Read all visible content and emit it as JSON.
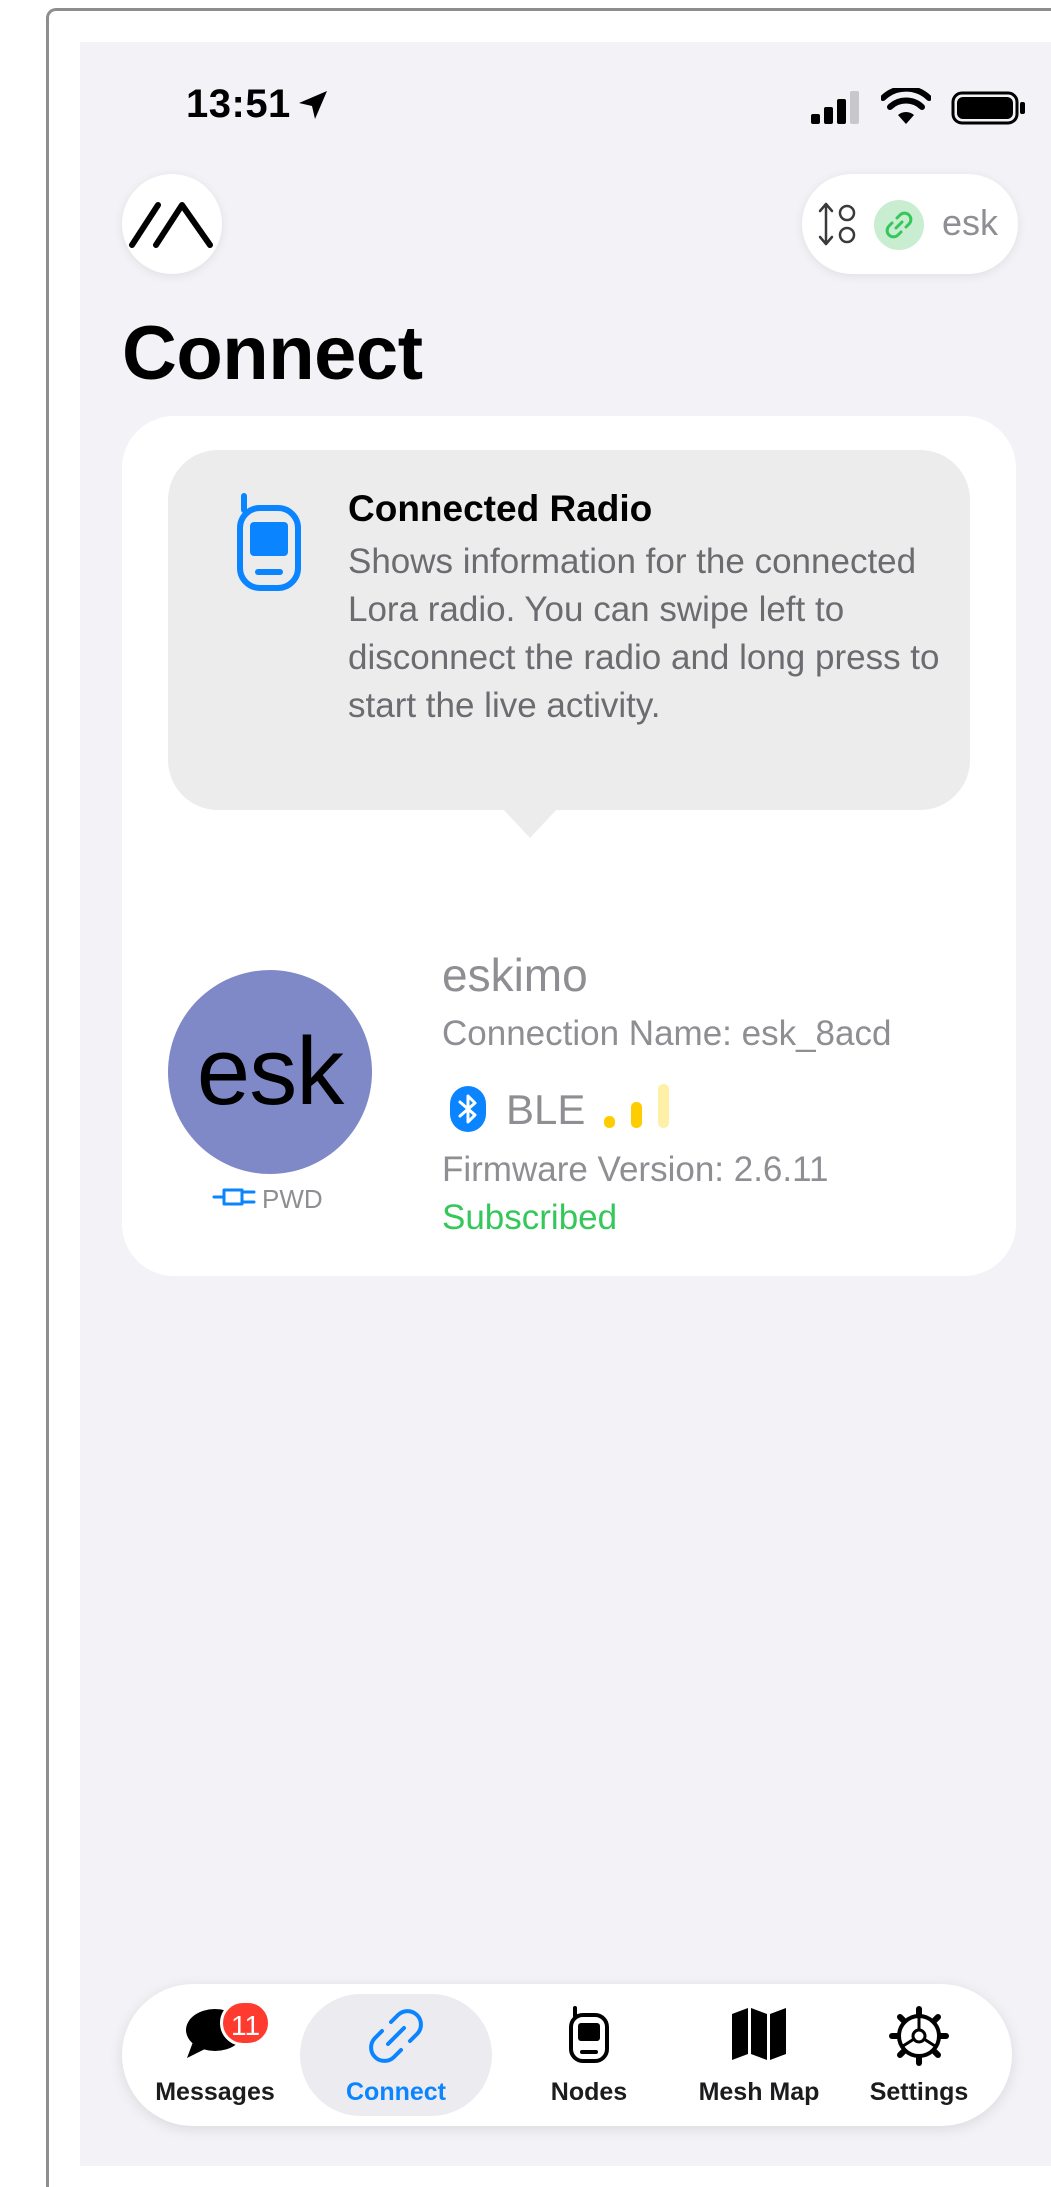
{
  "status_bar": {
    "time": "13:51",
    "icons": [
      "location-arrow-icon",
      "cellular-signal-icon",
      "wifi-icon",
      "battery-icon"
    ]
  },
  "header": {
    "connection_pill": {
      "name": "esk",
      "icons": [
        "sort-arrows-icon",
        "link-icon"
      ]
    }
  },
  "page": {
    "title": "Connect"
  },
  "tip": {
    "title": "Connected Radio",
    "body": "Shows information for the connected Lora radio. You can swipe left to disconnect the radio and long press to start the live activity."
  },
  "radio": {
    "avatar_text": "esk",
    "avatar_color": "#7f89c8",
    "power_label": "PWD",
    "name": "eskimo",
    "connection_name": "Connection Name: esk_8acd",
    "transport": "BLE",
    "signal_strength": "2 of 3",
    "firmware": "Firmware Version: 2.6.11",
    "status": "Subscribed",
    "status_color": "#34c759"
  },
  "tabbar": {
    "tabs": [
      {
        "label": "Messages",
        "icon": "chat-bubble-icon",
        "badge": "11"
      },
      {
        "label": "Connect",
        "icon": "link-icon",
        "active": true
      },
      {
        "label": "Nodes",
        "icon": "radio-device-icon"
      },
      {
        "label": "Mesh Map",
        "icon": "map-icon"
      },
      {
        "label": "Settings",
        "icon": "gear-icon"
      }
    ]
  },
  "colors": {
    "accent": "#0a84ff",
    "background": "#f2f2f7",
    "signal_active": "#ffcc00",
    "signal_inactive": "#fff0a8"
  }
}
